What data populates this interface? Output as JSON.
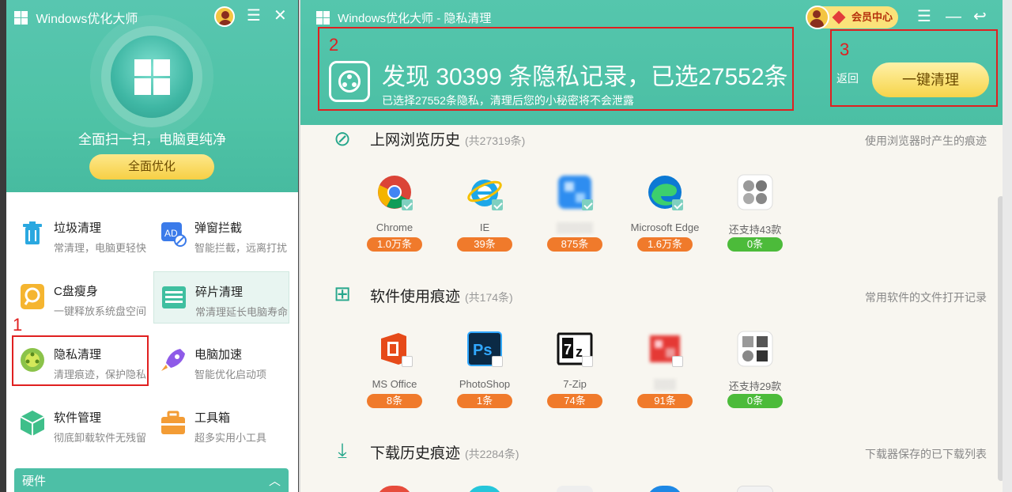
{
  "left": {
    "title": "Windows优化大师",
    "slogan": "全面扫一扫，电脑更纯净",
    "full_button": "全面优化",
    "features": [
      {
        "name": "垃圾清理",
        "desc": "常清理，电脑更轻快",
        "icon": "trash-icon"
      },
      {
        "name": "弹窗拦截",
        "desc": "智能拦截，远离打扰",
        "icon": "ad-block-icon"
      },
      {
        "name": "C盘瘦身",
        "desc": "一键释放系统盘空间",
        "icon": "disk-slim-icon"
      },
      {
        "name": "碎片清理",
        "desc": "常清理延长电脑寿命",
        "icon": "defrag-icon"
      },
      {
        "name": "隐私清理",
        "desc": "清理痕迹，保护隐私",
        "icon": "privacy-icon"
      },
      {
        "name": "电脑加速",
        "desc": "智能优化启动项",
        "icon": "rocket-icon"
      },
      {
        "name": "软件管理",
        "desc": "彻底卸载软件无残留",
        "icon": "cube-icon"
      },
      {
        "name": "工具箱",
        "desc": "超多实用小工具",
        "icon": "toolbox-icon"
      }
    ],
    "hardware_label": "硬件",
    "callout_1": "1"
  },
  "right": {
    "title": "Windows优化大师 - 隐私清理",
    "vip_label": "会员中心",
    "callout_2": "2",
    "callout_3": "3",
    "headline": "发现 30399 条隐私记录，已选27552条",
    "subline": "已选择27552条隐私，清理后您的小秘密将不会泄露",
    "back_label": "返回",
    "clean_button": "一键清理",
    "sections": [
      {
        "title": "上网浏览历史",
        "count": "(共27319条)",
        "note": "使用浏览器时产生的痕迹",
        "icon": "browser-history-icon",
        "apps": [
          {
            "label": "Chrome",
            "badge": "1.0万条",
            "icon": "chrome-icon",
            "checked": true
          },
          {
            "label": "IE",
            "badge": "39条",
            "icon": "ie-icon",
            "checked": true
          },
          {
            "label": "",
            "badge": "875条",
            "icon": "blurred-browser-icon",
            "checked": true
          },
          {
            "label": "Microsoft Edge",
            "badge": "1.6万条",
            "icon": "edge-icon",
            "checked": true
          },
          {
            "label": "还支持43款",
            "badge": "0条",
            "icon": "more-browsers-icon",
            "checked": false
          }
        ]
      },
      {
        "title": "软件使用痕迹",
        "count": "(共174条)",
        "note": "常用软件的文件打开记录",
        "icon": "software-trace-icon",
        "apps": [
          {
            "label": "MS Office",
            "badge": "8条",
            "icon": "office-icon",
            "checked": false
          },
          {
            "label": "PhotoShop",
            "badge": "1条",
            "icon": "photoshop-icon",
            "checked": false
          },
          {
            "label": "7-Zip",
            "badge": "74条",
            "icon": "7zip-icon",
            "checked": false
          },
          {
            "label": "",
            "badge": "91条",
            "icon": "blurred-app-icon",
            "checked": false
          },
          {
            "label": "还支持29款",
            "badge": "0条",
            "icon": "more-apps-icon",
            "checked": false
          }
        ]
      },
      {
        "title": "下载历史痕迹",
        "count": "(共2284条)",
        "note": "下载器保存的已下载列表",
        "icon": "download-icon"
      }
    ]
  }
}
